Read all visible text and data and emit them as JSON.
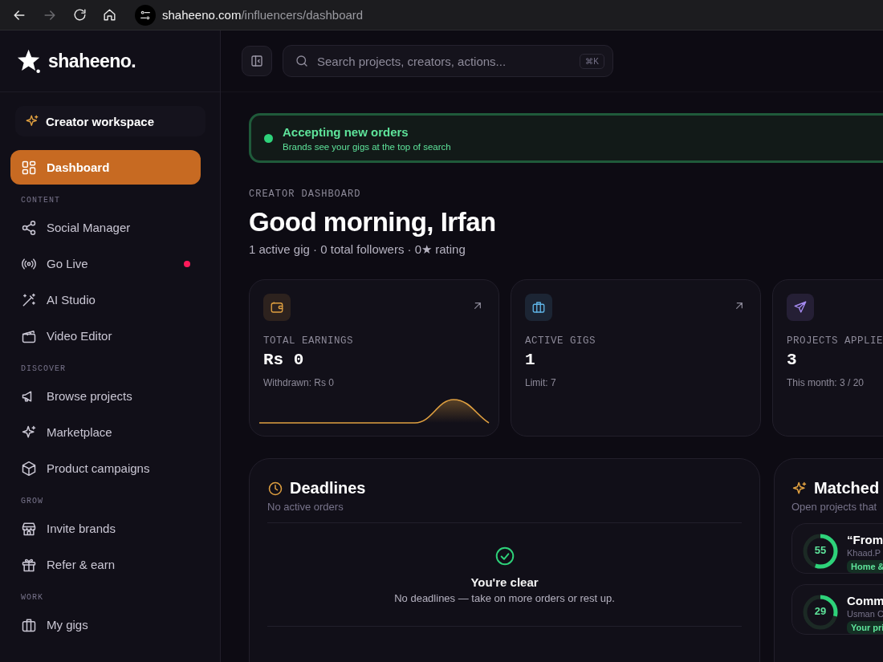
{
  "browser": {
    "url_host": "shaheeno.com",
    "url_path": "/influencers/dashboard",
    "forward_disabled": true
  },
  "sidebar": {
    "brand": "shaheeno.",
    "workspace": "Creator workspace",
    "top_items": [
      {
        "label": "Dashboard",
        "selected": true,
        "notification": false
      }
    ],
    "sections": [
      {
        "title": "CONTENT",
        "items": [
          {
            "label": "Social Manager",
            "selected": false,
            "notification": false
          },
          {
            "label": "Go Live",
            "selected": false,
            "notification": true
          },
          {
            "label": "AI Studio",
            "selected": false,
            "notification": false
          },
          {
            "label": "Video Editor",
            "selected": false,
            "notification": false
          }
        ]
      },
      {
        "title": "DISCOVER",
        "items": [
          {
            "label": "Browse projects",
            "selected": false,
            "notification": false
          },
          {
            "label": "Marketplace",
            "selected": false,
            "notification": false
          },
          {
            "label": "Product campaigns",
            "selected": false,
            "notification": false
          }
        ]
      },
      {
        "title": "GROW",
        "items": [
          {
            "label": "Invite brands",
            "selected": false,
            "notification": false
          },
          {
            "label": "Refer & earn",
            "selected": false,
            "notification": false
          }
        ]
      },
      {
        "title": "WORK",
        "items": [
          {
            "label": "My gigs",
            "selected": false,
            "notification": false
          }
        ]
      }
    ]
  },
  "topbar": {
    "search": {
      "placeholder": "Search projects, creators, actions...",
      "shortcut": "⌘K"
    }
  },
  "banner": {
    "on": true,
    "title": "Accepting new orders",
    "subtitle": "Brands see your gigs at the top of search"
  },
  "header": {
    "eyebrow": "CREATOR DASHBOARD",
    "title": "Good morning, Irfan",
    "subtitle": "1 active gig · 0 total followers · 0★ rating"
  },
  "stats": [
    {
      "kind": "wallet",
      "label": "TOTAL EARNINGS",
      "value": "Rs 0",
      "note": "Withdrawn: Rs 0",
      "color": "#e0a040",
      "link": true,
      "sparkline": true
    },
    {
      "kind": "briefcase",
      "label": "ACTIVE GIGS",
      "value": "1",
      "note": "Limit: 7",
      "color": "#5fb4e6",
      "link": true,
      "sparkline": false
    },
    {
      "kind": "send",
      "label": "PROJECTS APPLIE",
      "value": "3",
      "note": "This month: 3 / 20",
      "color": "#a58af0",
      "link": false,
      "sparkline": false
    }
  ],
  "deadlines": {
    "title": "Deadlines",
    "subtitle": "No active orders",
    "empty_title": "You're clear",
    "empty_text": "No deadlines — take on more orders or rest up."
  },
  "matched": {
    "title": "Matched",
    "subtitle": "Open projects that",
    "items": [
      {
        "score": "55",
        "level": 0.55,
        "title": "“From",
        "author": "Khaad.P",
        "tag": "Home &"
      },
      {
        "score": "29",
        "level": 0.29,
        "title": "Comm",
        "author": "Usman C",
        "tag": "Your pri"
      }
    ]
  }
}
